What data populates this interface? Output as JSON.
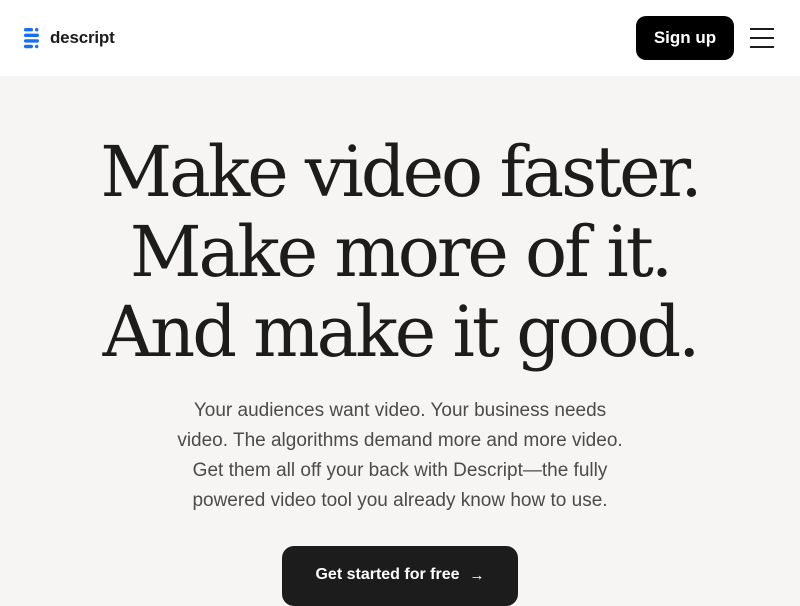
{
  "header": {
    "brand_name": "descript",
    "signup_label": "Sign up",
    "menu_icon": "hamburger-menu-icon"
  },
  "hero": {
    "headline_lines": [
      "Make video faster.",
      "Make more of it.",
      "And make it good."
    ],
    "subcopy_lines": [
      "Your audiences want video. Your business needs",
      "video. The algorithms demand more and more video.",
      "Get them all off your back with Descript—the fully",
      "powered video tool you already know how to use."
    ],
    "cta_label": "Get started for free",
    "cta_icon": "arrow-right-icon"
  },
  "colors": {
    "brand_blue": "#1a6ef5",
    "background": "#f6f5f3",
    "header_bg": "#ffffff",
    "button_dark": "#1c1c1c"
  }
}
